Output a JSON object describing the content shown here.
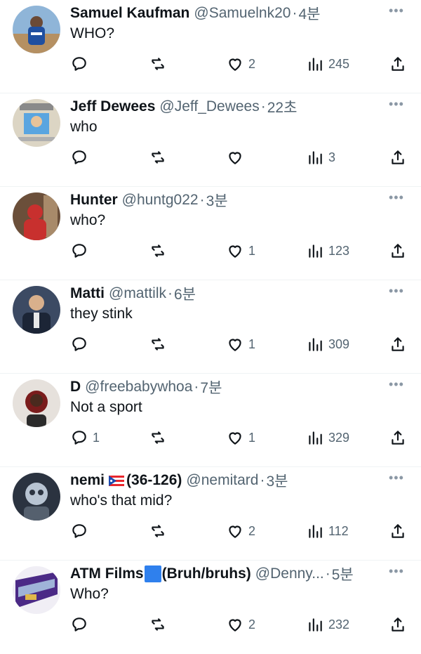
{
  "tweets": [
    {
      "name": "Samuel Kaufman",
      "handle": "@Samuelnk20",
      "time": "4분",
      "text": "WHO?",
      "replies": "",
      "likes": "2",
      "views": "245",
      "avatar_color": "#2a5ea8"
    },
    {
      "name": "Jeff Dewees",
      "handle": "@Jeff_Dewees",
      "time": "22초",
      "text": "who",
      "replies": "",
      "likes": "",
      "views": "3",
      "avatar_color": "#5aa5e0"
    },
    {
      "name": "Hunter",
      "handle": "@huntg022",
      "time": "3분",
      "text": "who?",
      "replies": "",
      "likes": "1",
      "views": "123",
      "avatar_color": "#c8302e"
    },
    {
      "name": "Matti",
      "handle": "@mattilk",
      "time": "6분",
      "text": "they stink",
      "replies": "",
      "likes": "1",
      "views": "309",
      "avatar_color": "#1c2536"
    },
    {
      "name": "D",
      "handle": "@freebabywhoa",
      "time": "7분",
      "text": "Not a sport",
      "replies": "1",
      "likes": "1",
      "views": "329",
      "avatar_color": "#7a1c1c"
    },
    {
      "name_main": "nemi",
      "name_rest": "(36-126)",
      "handle": "@nemitard",
      "time": "3분",
      "text": "who's that mid?",
      "replies": "",
      "likes": "2",
      "views": "112",
      "avatar_color": "#2b3340"
    },
    {
      "name_main": "ATM Films",
      "name_rest": "(Bruh/bruhs)",
      "handle": "@Denny...",
      "time": "5분",
      "text": "Who?",
      "replies": "",
      "likes": "2",
      "views": "232",
      "avatar_color": "#4b2a86"
    }
  ],
  "separator": "·",
  "icons": {
    "reply": "reply-icon",
    "retweet": "retweet-icon",
    "like": "like-icon",
    "views": "views-icon",
    "share": "share-icon",
    "more": "more-icon"
  },
  "colors": {
    "text": "#0f1419",
    "secondary": "#536471",
    "divider": "#eff3f4",
    "square_emoji": "#2f80ed"
  }
}
